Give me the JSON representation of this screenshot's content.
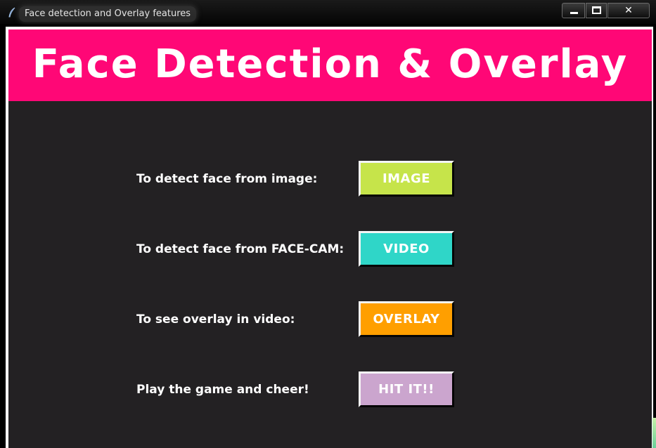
{
  "window": {
    "title": "Face detection and Overlay features",
    "icon": "feather-icon",
    "controls": {
      "minimize": "minimize-icon",
      "maximize": "maximize-icon",
      "close_label": "✕"
    }
  },
  "header": {
    "title": "Face Detection & Overlay",
    "background": "#ff0776"
  },
  "client_background": "#232123",
  "rows": [
    {
      "label": "To detect face from image:",
      "button_label": "IMAGE",
      "button_color": "#c6e44a"
    },
    {
      "label": "To detect face from FACE-CAM:",
      "button_label": "VIDEO",
      "button_color": "#2fd6c8"
    },
    {
      "label": "To see overlay in video:",
      "button_label": "OVERLAY",
      "button_color": "#ff9f00"
    },
    {
      "label": "Play the game and cheer!",
      "button_label": "HIT IT!!",
      "button_color": "#cba5ce"
    }
  ]
}
